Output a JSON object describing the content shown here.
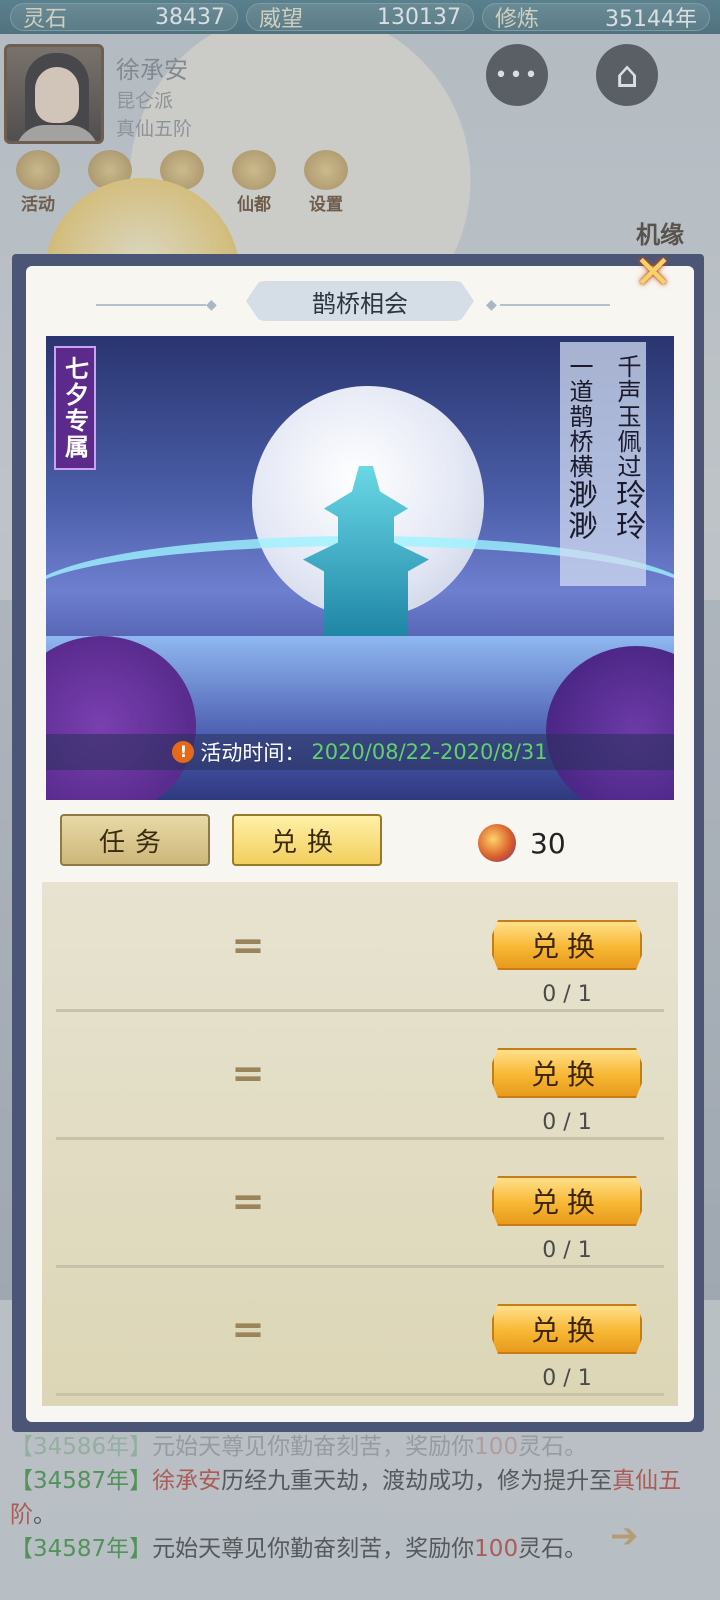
{
  "resources": [
    {
      "label": "灵石",
      "value": "38437"
    },
    {
      "label": "威望",
      "value": "130137"
    },
    {
      "label": "修炼",
      "value": "35144年"
    }
  ],
  "player": {
    "name": "徐承安",
    "sect": "昆仑派",
    "rank": "真仙五阶"
  },
  "header_buttons": {
    "more_glyph": "•••",
    "home_glyph": "⌂"
  },
  "menu": [
    {
      "label": "活动",
      "icon": "coin-icon"
    },
    {
      "label": "",
      "icon": "gift-icon"
    },
    {
      "label": "",
      "icon": "mail-icon"
    },
    {
      "label": "仙都",
      "icon": "pavilion-icon"
    },
    {
      "label": "设置",
      "icon": "gear-icon"
    }
  ],
  "jiyuan_label": "机缘",
  "modal": {
    "title": "鹊桥相会",
    "close_glyph": "✕",
    "banner": {
      "tag": "七夕专属",
      "poem_lines": [
        {
          "small": "千声玉佩过",
          "big": "玲玲"
        },
        {
          "small": "一道鹊桥横",
          "big": "渺渺"
        }
      ],
      "time_label": "活动时间：",
      "time_range": "2020/08/22-2020/8/31",
      "warn_glyph": "!"
    },
    "tabs": [
      {
        "label": "任务",
        "active": false
      },
      {
        "label": "兑换",
        "active": true
      }
    ],
    "token_count": "30",
    "items": [
      {
        "equals": "=",
        "button": "兑换",
        "progress": "0 / 1"
      },
      {
        "equals": "=",
        "button": "兑换",
        "progress": "0 / 1"
      },
      {
        "equals": "=",
        "button": "兑换",
        "progress": "0 / 1"
      },
      {
        "equals": "=",
        "button": "兑换",
        "progress": "0 / 1"
      }
    ]
  },
  "log": [
    {
      "yr": "【34586年】",
      "name": "",
      "text": "元始天尊见你勤奋刻苦，奖励你",
      "amount": "100",
      "tail": "灵石。"
    },
    {
      "yr": "【34587年】",
      "name": "徐承安",
      "text": "历经九重天劫，渡劫成功，修为提升至",
      "amount": "真仙五阶",
      "tail": "。"
    },
    {
      "yr": "【34587年】",
      "name": "",
      "text": "元始天尊见你勤奋刻苦，奖励你",
      "amount": "100",
      "tail": "灵石。"
    }
  ],
  "colors": {
    "accent_gold": "#f2cf5e",
    "year_green": "#2e8a2e",
    "highlight_red": "#b5382a",
    "time_green": "#5fd36a"
  }
}
